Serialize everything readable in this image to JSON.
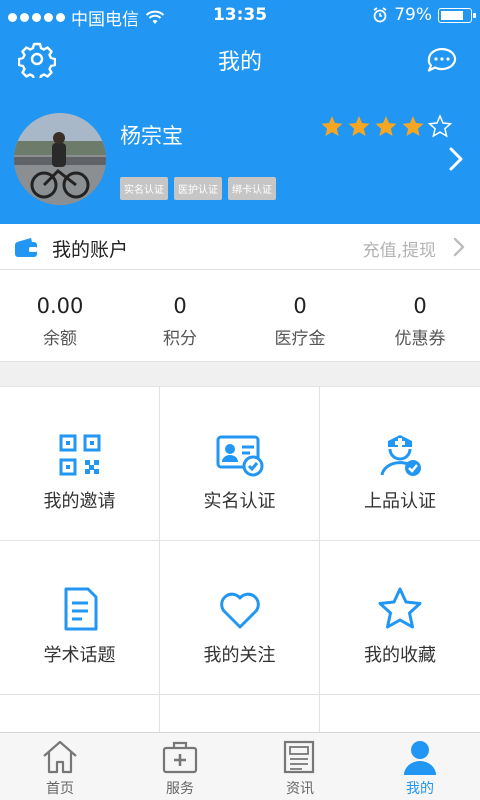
{
  "status_bar": {
    "carrier": "中国电信",
    "time": "13:35",
    "battery_percent": "79%",
    "battery_level": 0.79
  },
  "header": {
    "title": "我的",
    "left_icon": "gear-icon",
    "right_icon": "message-icon"
  },
  "profile": {
    "name": "杨宗宝",
    "rating": 4,
    "rating_max": 5,
    "badges": [
      "实名认证",
      "医护认证",
      "绑卡认证"
    ]
  },
  "account": {
    "label": "我的账户",
    "action_hint": "充值,提现"
  },
  "stats": [
    {
      "value": "0.00",
      "label": "余额"
    },
    {
      "value": "0",
      "label": "积分"
    },
    {
      "value": "0",
      "label": "医疗金"
    },
    {
      "value": "0",
      "label": "优惠券"
    }
  ],
  "menu": [
    {
      "label": "我的邀请",
      "icon": "qr-code-icon"
    },
    {
      "label": "实名认证",
      "icon": "id-card-icon"
    },
    {
      "label": "上品认证",
      "icon": "nurse-icon"
    },
    {
      "label": "学术话题",
      "icon": "document-icon"
    },
    {
      "label": "我的关注",
      "icon": "heart-icon"
    },
    {
      "label": "我的收藏",
      "icon": "star-icon"
    }
  ],
  "tabbar": [
    {
      "label": "首页",
      "icon": "home-icon",
      "active": false
    },
    {
      "label": "服务",
      "icon": "medical-kit-icon",
      "active": false
    },
    {
      "label": "资讯",
      "icon": "news-icon",
      "active": false
    },
    {
      "label": "我的",
      "icon": "user-icon",
      "active": true
    }
  ],
  "colors": {
    "accent": "#2196f3",
    "star": "#f5a623",
    "badge_bg": "#c6c6c6"
  }
}
